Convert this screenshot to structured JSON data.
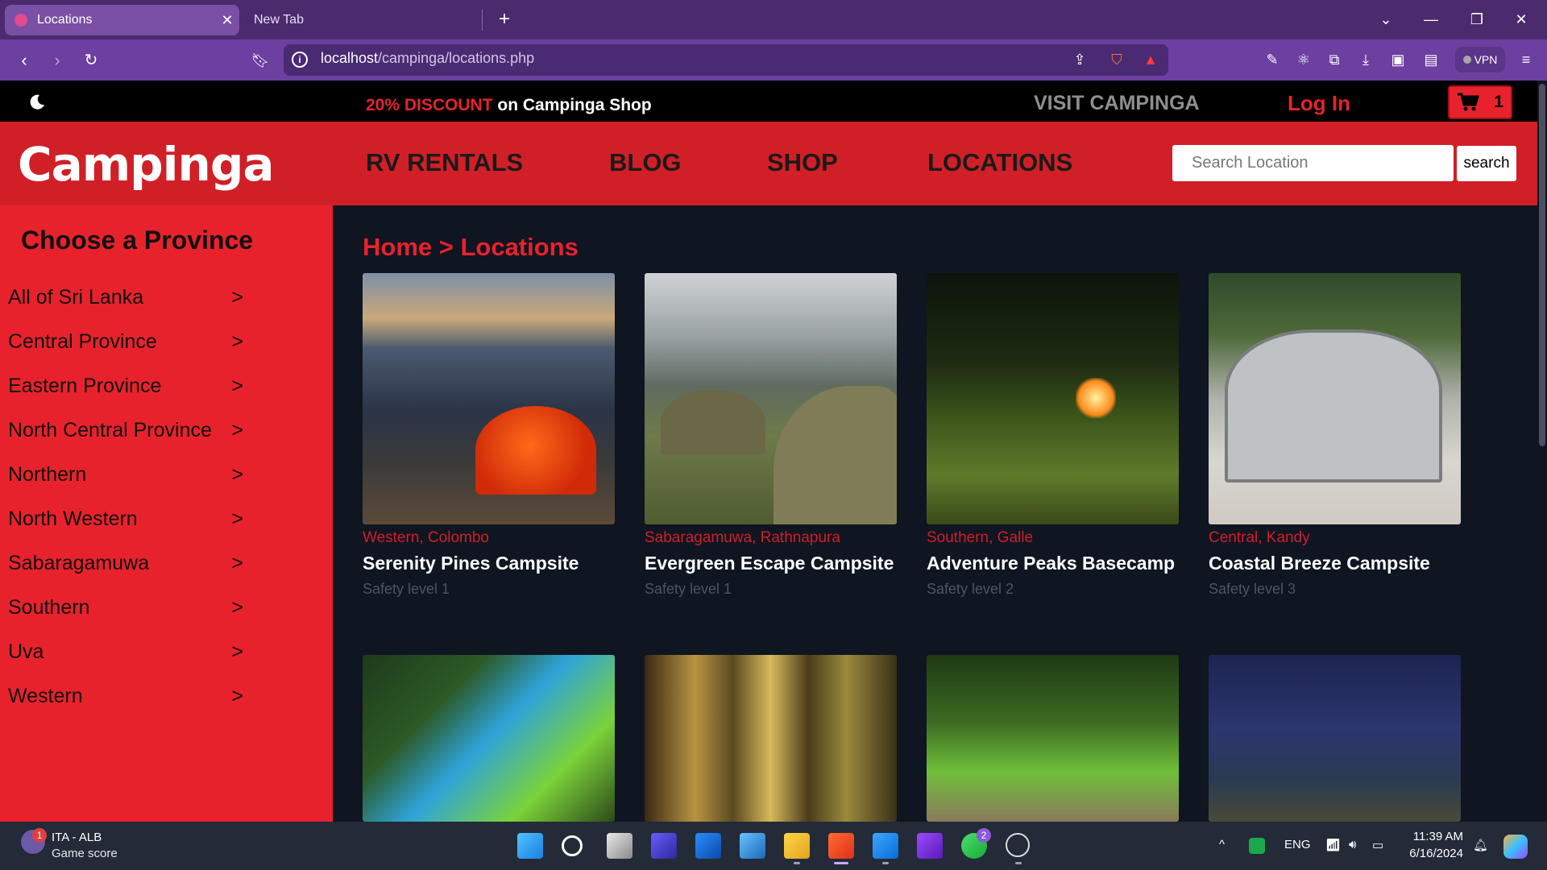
{
  "browser": {
    "tabs": [
      {
        "title": "Locations",
        "active": true
      },
      {
        "title": "New Tab",
        "active": false
      }
    ],
    "url_host": "localhost",
    "url_path": "/campinga/locations.php",
    "vpn_label": "VPN"
  },
  "topbar": {
    "discount_highlight": "20% DISCOUNT",
    "discount_rest": " on Campinga Shop",
    "visit": "VISIT CAMPINGA",
    "login": "Log In",
    "cart_count": "1"
  },
  "header": {
    "logo": "Campinga",
    "nav": [
      "RV RENTALS",
      "BLOG",
      "SHOP",
      "LOCATIONS"
    ],
    "search_placeholder": "Search Location",
    "search_button": "search"
  },
  "sidebar": {
    "title": "Choose a Province",
    "items": [
      "All of Sri Lanka",
      "Central Province",
      "Eastern Province",
      "North Central Province",
      "Northern",
      "North Western",
      "Sabaragamuwa",
      "Southern",
      "Uva",
      "Western"
    ],
    "chevron": ">"
  },
  "main": {
    "breadcrumb": "Home > Locations",
    "cards": [
      {
        "location": "Western, Colombo",
        "title": "Serenity Pines Campsite",
        "safety": "Safety level 1"
      },
      {
        "location": "Sabaragamuwa, Rathnapura",
        "title": "Evergreen Escape Campsite",
        "safety": "Safety level 1"
      },
      {
        "location": "Southern, Galle",
        "title": "Adventure Peaks Basecamp",
        "safety": "Safety level 2"
      },
      {
        "location": "Central, Kandy",
        "title": "Coastal Breeze Campsite",
        "safety": "Safety level 3"
      },
      {
        "location": "",
        "title": "",
        "safety": ""
      },
      {
        "location": "",
        "title": "",
        "safety": ""
      },
      {
        "location": "",
        "title": "",
        "safety": ""
      },
      {
        "location": "",
        "title": "",
        "safety": ""
      }
    ]
  },
  "taskbar": {
    "widget_badge": "1",
    "widget_line1": "ITA - ALB",
    "widget_line2": "Game score",
    "whatsapp_badge": "2",
    "lang": "ENG",
    "time": "11:39 AM",
    "date": "6/16/2024"
  },
  "colors": {
    "brand_red": "#e8222c",
    "header_red": "#d11f27",
    "browser_purple": "#6c3fa0",
    "page_dark": "#0f1521"
  }
}
